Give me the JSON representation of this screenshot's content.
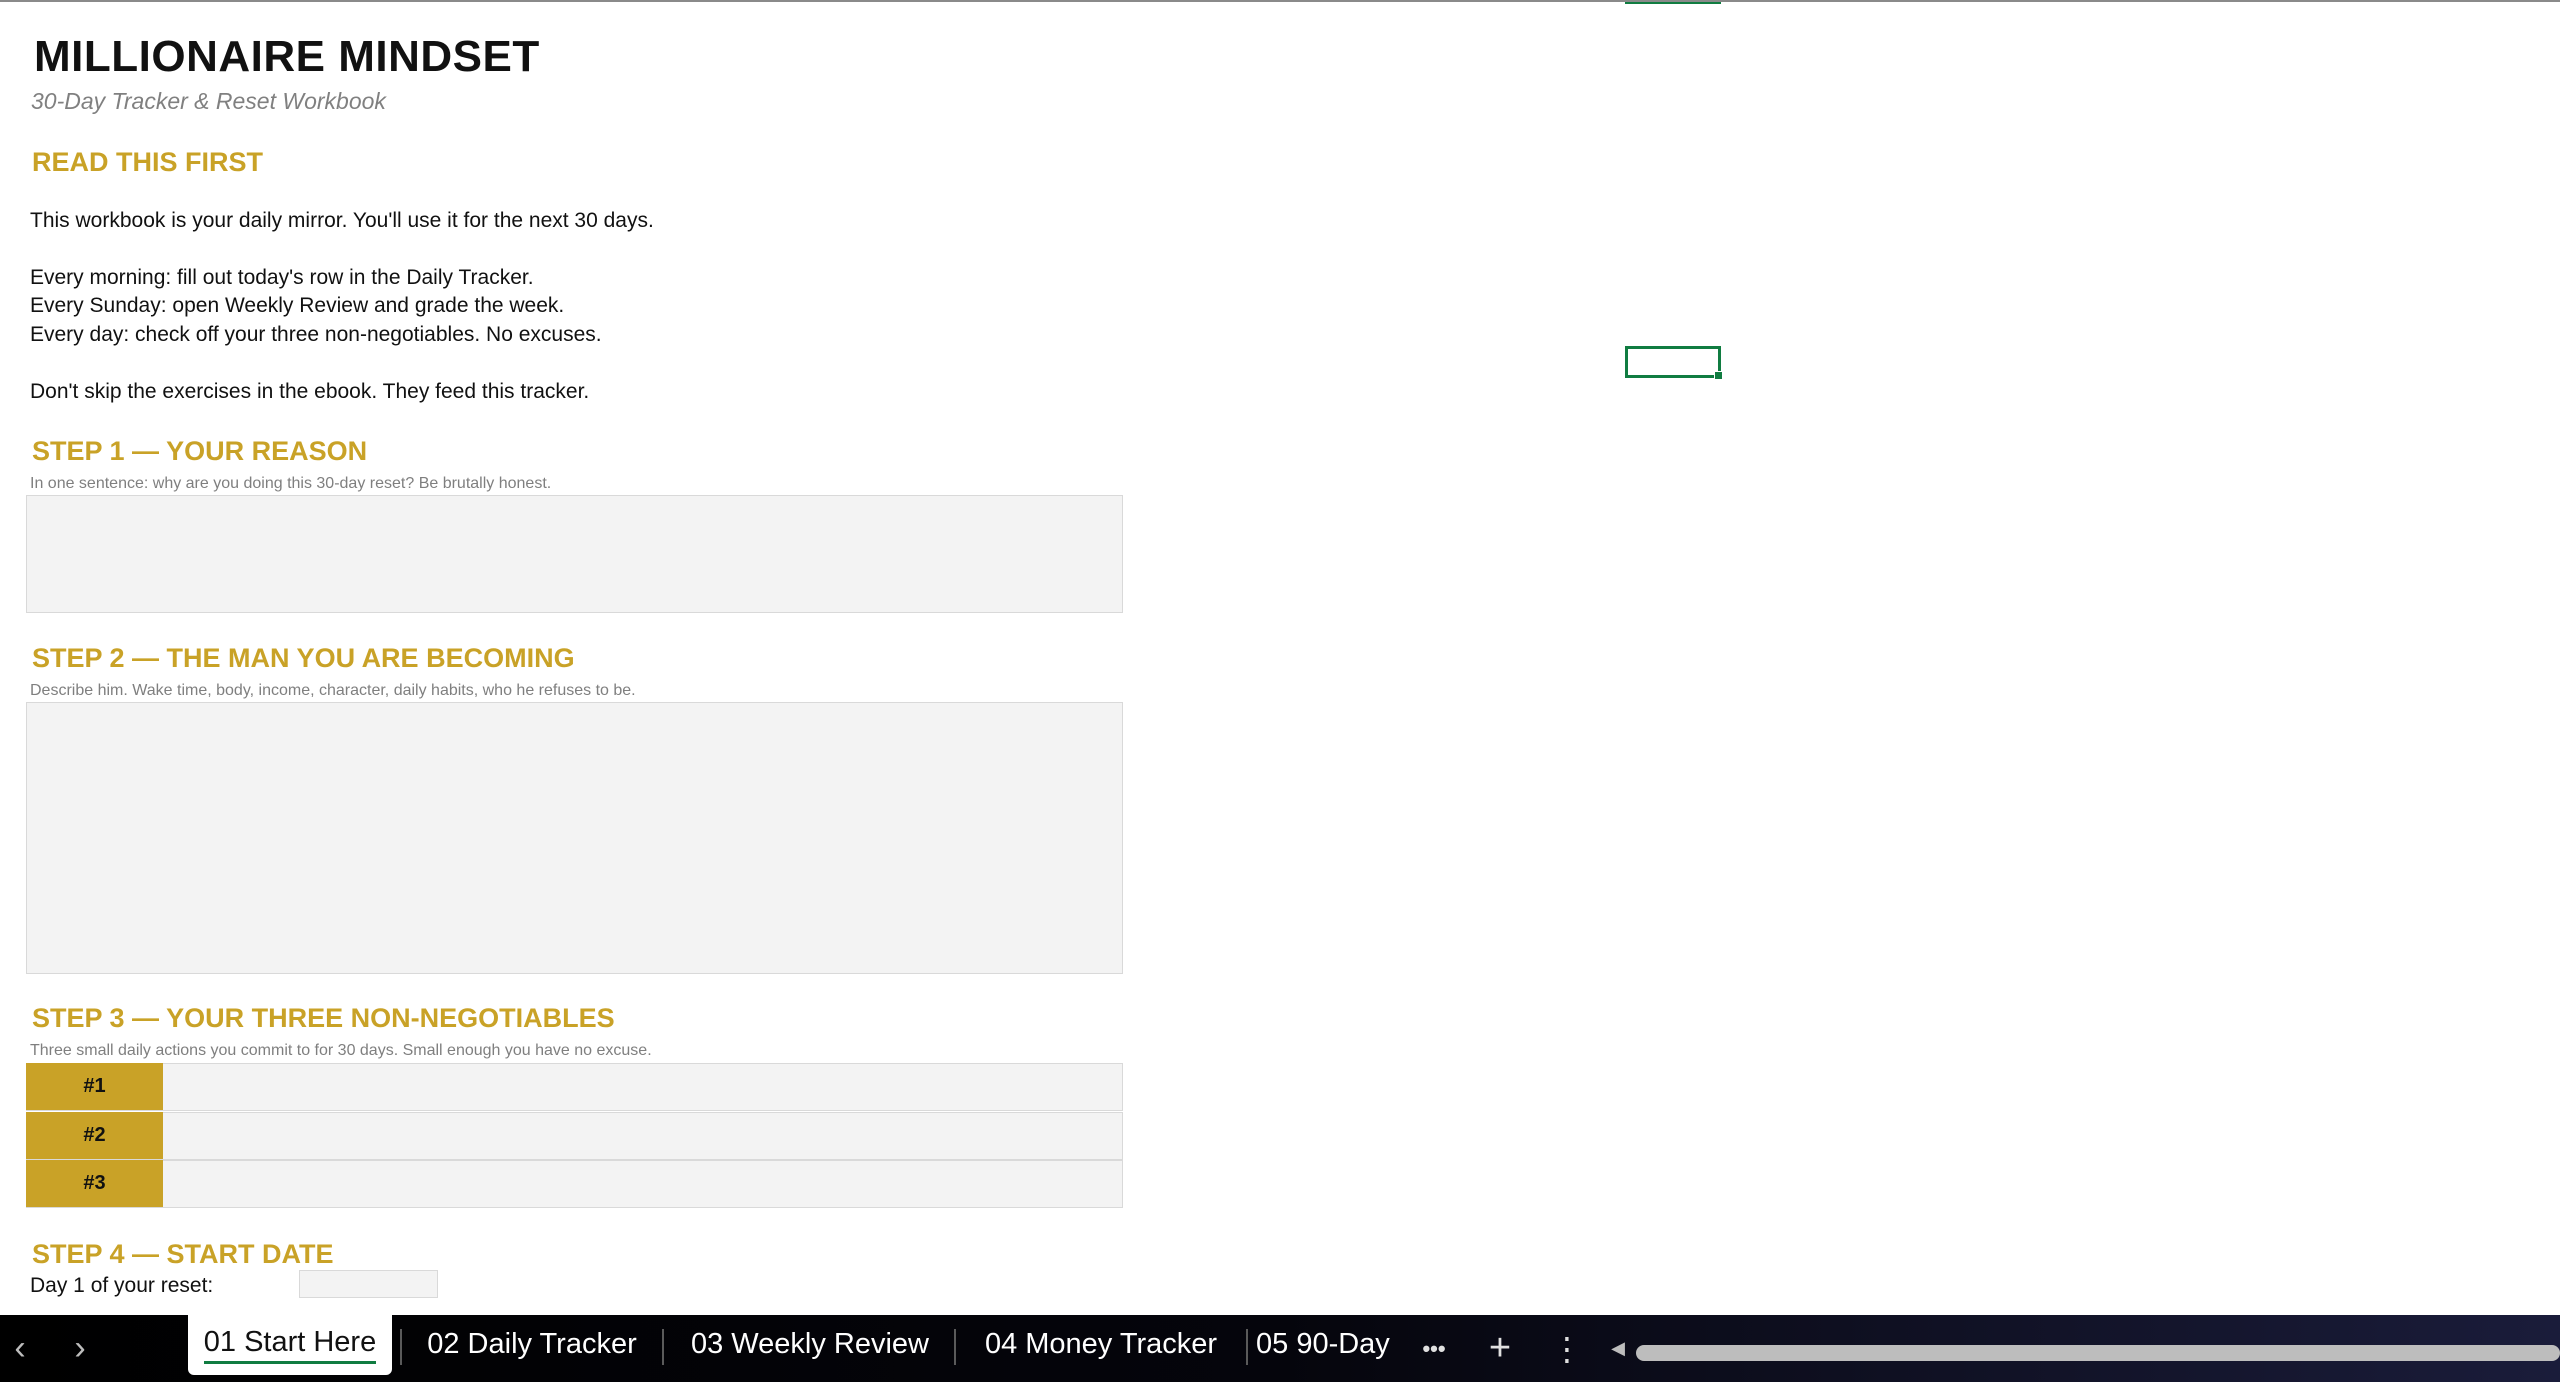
{
  "header": {
    "title": "MILLIONAIRE MINDSET",
    "subtitle": "30-Day Tracker & Reset Workbook"
  },
  "read_first": {
    "heading": "READ THIS FIRST",
    "lines": [
      "This workbook is your daily mirror. You'll use it for the next 30 days.",
      "Every morning: fill out today's row in the Daily Tracker.",
      "Every Sunday: open Weekly Review and grade the week.",
      "Every day: check off your three non-negotiables. No excuses.",
      "Don't skip the exercises in the ebook. They feed this tracker."
    ]
  },
  "step1": {
    "heading": "STEP 1 — YOUR REASON",
    "hint": "In one sentence: why are you doing this 30-day reset? Be brutally honest.",
    "value": ""
  },
  "step2": {
    "heading": "STEP 2 — THE MAN YOU ARE BECOMING",
    "hint": "Describe him. Wake time, body, income, character, daily habits, who he refuses to be.",
    "value": ""
  },
  "step3": {
    "heading": "STEP 3 — YOUR THREE NON-NEGOTIABLES",
    "hint": "Three small daily actions you commit to for 30 days. Small enough you have no excuse.",
    "items": [
      {
        "label": "#1",
        "value": ""
      },
      {
        "label": "#2",
        "value": ""
      },
      {
        "label": "#3",
        "value": ""
      }
    ]
  },
  "step4": {
    "heading": "STEP 4 — START DATE",
    "label": "Day 1 of your reset:",
    "value": ""
  },
  "tabs": {
    "items": [
      {
        "label": "01 Start Here",
        "active": true
      },
      {
        "label": "02 Daily Tracker",
        "active": false
      },
      {
        "label": "03 Weekly Review",
        "active": false
      },
      {
        "label": "04 Money Tracker",
        "active": false
      },
      {
        "label": "05 90-Day",
        "active": false
      }
    ],
    "more_glyph": "•••",
    "add_glyph": "+",
    "options_glyph": "⋮",
    "prev_glyph": "‹",
    "next_glyph": "›",
    "scroll_left_glyph": "◀"
  },
  "colors": {
    "accent_gold": "#c9a227",
    "selection_green": "#107c41",
    "input_fill": "#f3f3f3"
  }
}
